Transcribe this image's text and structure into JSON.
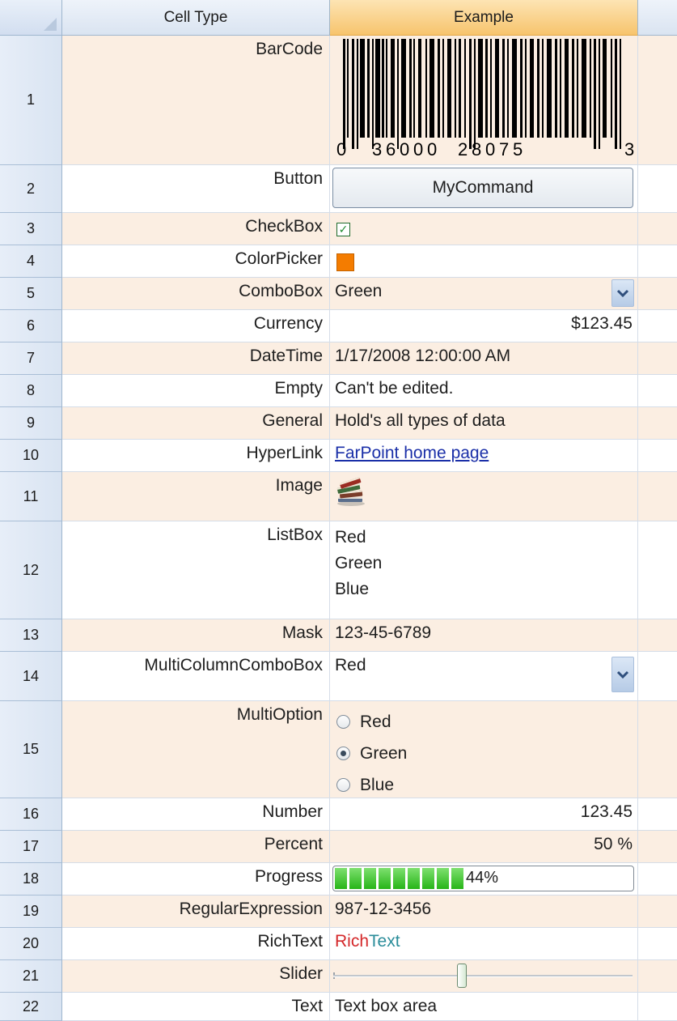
{
  "header": {
    "col_type": "Cell Type",
    "col_example": "Example"
  },
  "accent_colors": {
    "selected_header": "#f7c46d",
    "alt_row": "#fbeee2",
    "color_picker_value": "#f47c00",
    "progress_fill": "#27b518",
    "hyperlink": "#1a2fa8"
  },
  "rows": [
    {
      "num": "1",
      "type": "BarCode",
      "barcode_digits": [
        "0",
        "3",
        "6",
        "0",
        "0",
        "0",
        "2",
        "8",
        "0",
        "7",
        "5",
        "3"
      ]
    },
    {
      "num": "2",
      "type": "Button",
      "value": "MyCommand"
    },
    {
      "num": "3",
      "type": "CheckBox",
      "checked": true,
      "check_glyph": "✓"
    },
    {
      "num": "4",
      "type": "ColorPicker",
      "color": "#f47c00"
    },
    {
      "num": "5",
      "type": "ComboBox",
      "value": "Green",
      "icon": "chevron-down-icon"
    },
    {
      "num": "6",
      "type": "Currency",
      "value": "$123.45"
    },
    {
      "num": "7",
      "type": "DateTime",
      "value": "1/17/2008 12:00:00 AM"
    },
    {
      "num": "8",
      "type": "Empty",
      "value": "Can't be edited."
    },
    {
      "num": "9",
      "type": "General",
      "value": "Hold's all types of data"
    },
    {
      "num": "10",
      "type": "HyperLink",
      "value": "FarPoint home page"
    },
    {
      "num": "11",
      "type": "Image",
      "icon": "books-icon"
    },
    {
      "num": "12",
      "type": "ListBox",
      "items": [
        "Red",
        "Green",
        "Blue"
      ]
    },
    {
      "num": "13",
      "type": "Mask",
      "value": "123-45-6789"
    },
    {
      "num": "14",
      "type": "MultiColumnComboBox",
      "value": "Red",
      "icon": "chevron-down-icon"
    },
    {
      "num": "15",
      "type": "MultiOption",
      "options": [
        "Red",
        "Green",
        "Blue"
      ],
      "selected": "Green"
    },
    {
      "num": "16",
      "type": "Number",
      "value": "123.45"
    },
    {
      "num": "17",
      "type": "Percent",
      "value": "50 %"
    },
    {
      "num": "18",
      "type": "Progress",
      "value": "44%",
      "progress": 0.44
    },
    {
      "num": "19",
      "type": "RegularExpression",
      "value": "987-12-3456"
    },
    {
      "num": "20",
      "type": "RichText",
      "value_part1": "Rich",
      "value_part2": "Text"
    },
    {
      "num": "21",
      "type": "Slider",
      "level": 0.43
    },
    {
      "num": "22",
      "type": "Text",
      "value": "Text box area"
    }
  ]
}
